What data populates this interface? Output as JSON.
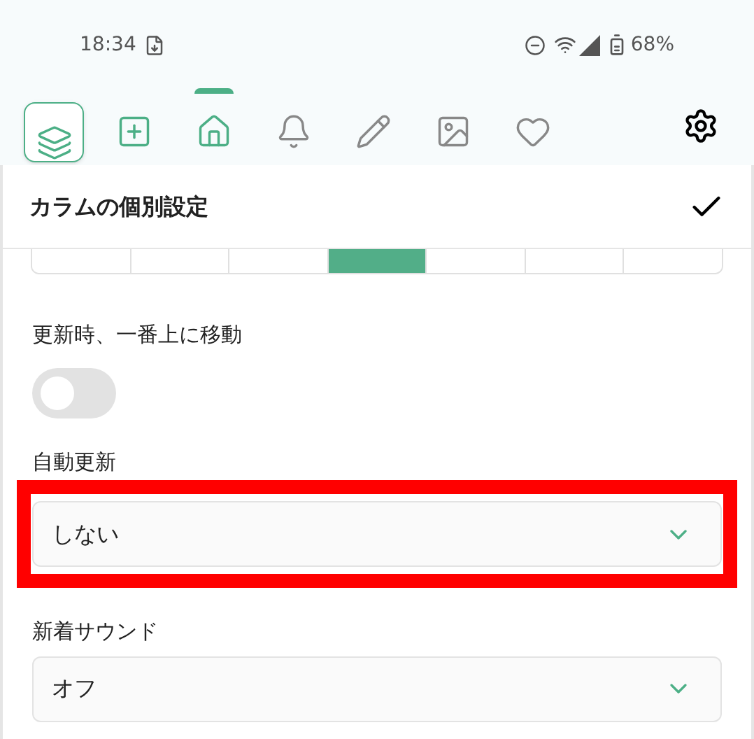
{
  "status_bar": {
    "time": "18:34",
    "battery": "68%"
  },
  "toolbar": {
    "items": [
      {
        "selected": false,
        "boxed": true,
        "accent": true
      },
      {
        "selected": false,
        "boxed": false,
        "accent": true
      },
      {
        "selected": true,
        "boxed": false,
        "accent": true
      },
      {
        "selected": false,
        "boxed": false,
        "accent": false
      },
      {
        "selected": false,
        "boxed": false,
        "accent": false
      },
      {
        "selected": false,
        "boxed": false,
        "accent": false
      },
      {
        "selected": false,
        "boxed": false,
        "accent": false
      }
    ]
  },
  "panel": {
    "title": "カラムの個別設定",
    "segments": [
      {
        "selected": false
      },
      {
        "selected": false
      },
      {
        "selected": false
      },
      {
        "selected": true
      },
      {
        "selected": false
      },
      {
        "selected": false
      },
      {
        "selected": false
      }
    ],
    "settings": [
      {
        "kind": "toggle",
        "label": "更新時、一番上に移動",
        "on": false
      },
      {
        "kind": "select",
        "label": "自動更新",
        "value": "しない",
        "highlighted": true
      },
      {
        "kind": "select",
        "label": "新着サウンド",
        "value": "オフ",
        "highlighted": false
      }
    ]
  }
}
